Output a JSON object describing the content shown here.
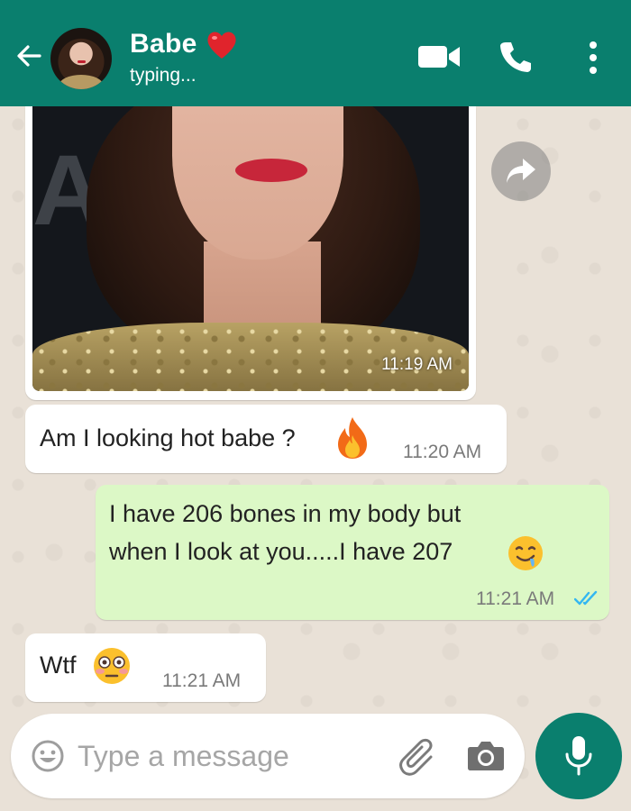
{
  "header": {
    "contact_name": "Babe",
    "status": "typing...",
    "color": "#0a7f6e"
  },
  "messages": [
    {
      "type": "image",
      "direction": "incoming",
      "time": "11:19 AM"
    },
    {
      "type": "text",
      "direction": "incoming",
      "text": "Am I looking hot babe ?",
      "emoji": "fire",
      "time": "11:20 AM"
    },
    {
      "type": "text",
      "direction": "outgoing",
      "line1": "I have 206 bones in my body but",
      "line2": "when I look at you.....I have 207",
      "emoji": "drooling-face",
      "time": "11:21 AM",
      "status": "read"
    },
    {
      "type": "text",
      "direction": "incoming",
      "text": "Wtf",
      "emoji": "flushed-face",
      "time": "11:21 AM"
    }
  ],
  "composer": {
    "placeholder": "Type a message"
  },
  "icons": [
    "back-arrow-icon",
    "video-call-icon",
    "phone-icon",
    "more-vert-icon",
    "forward-icon",
    "emoji-icon",
    "attach-icon",
    "camera-icon",
    "mic-icon",
    "double-check-icon"
  ]
}
